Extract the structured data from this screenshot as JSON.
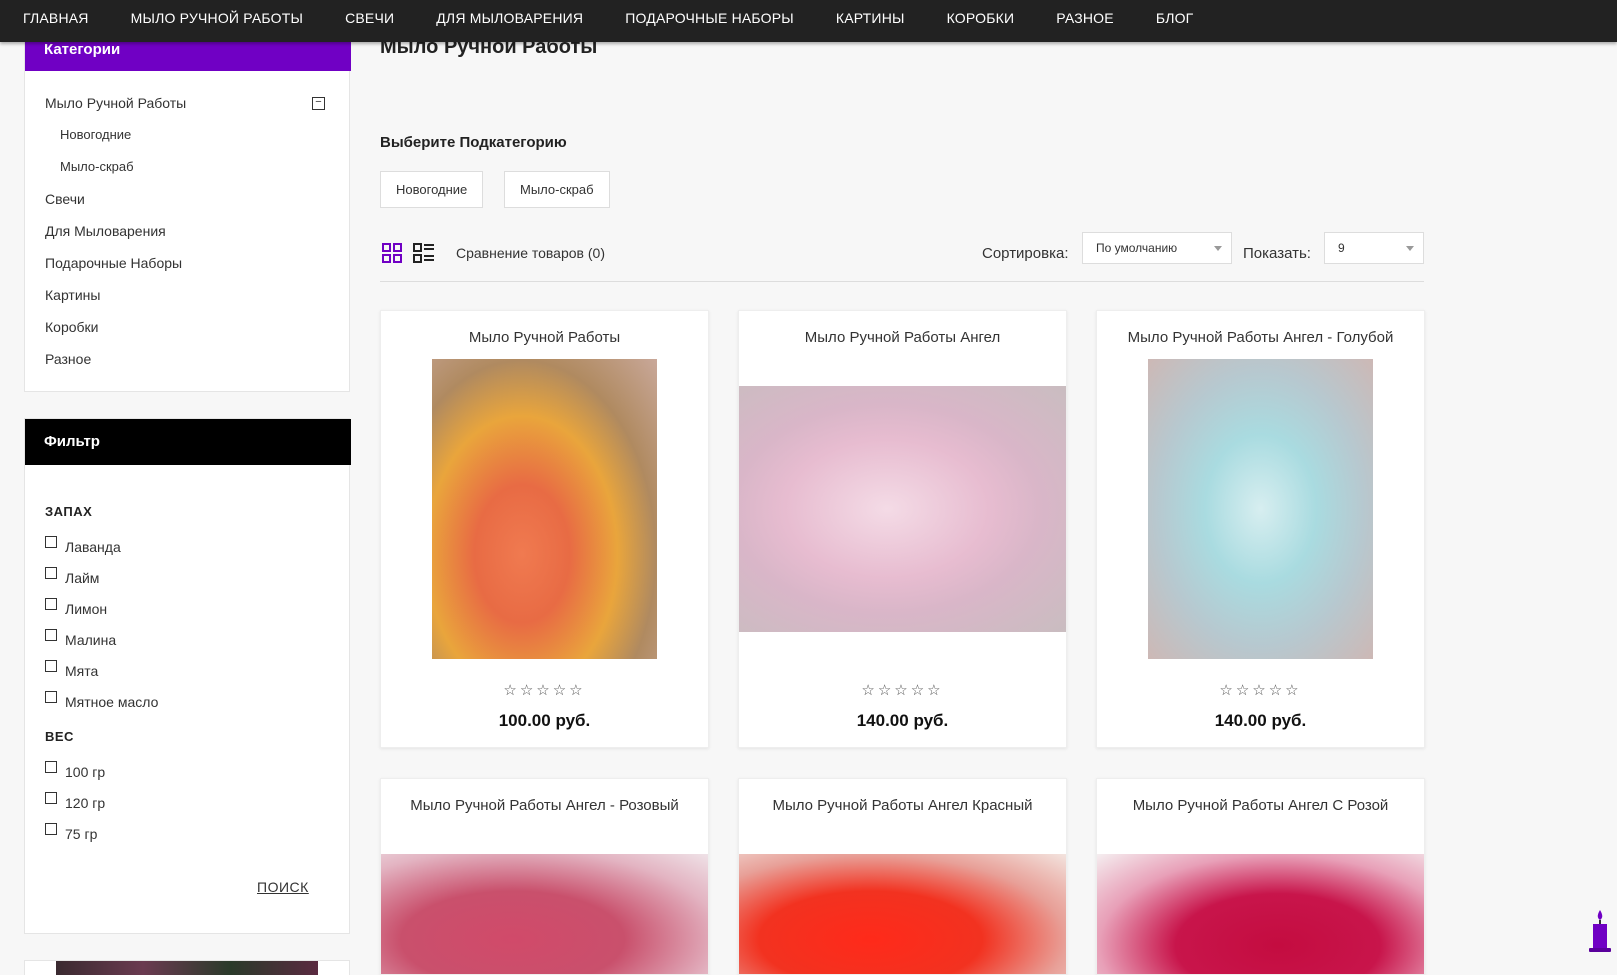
{
  "nav": {
    "items": [
      "ГЛАВНАЯ",
      "МЫЛО РУЧНОЙ РАБОТЫ",
      "СВЕЧИ",
      "ДЛЯ МЫЛОВАРЕНИЯ",
      "ПОДАРОЧНЫЕ НАБОРЫ",
      "КАРТИНЫ",
      "КОРОБКИ",
      "РАЗНОЕ",
      "БЛОГ"
    ]
  },
  "categories": {
    "title": "Категории",
    "items": [
      {
        "label": "Мыло Ручной Работы",
        "expanded": true
      },
      {
        "label": "Новогодние",
        "sub": true
      },
      {
        "label": "Мыло-скраб",
        "sub": true
      },
      {
        "label": "Свечи"
      },
      {
        "label": "Для Мыловарения"
      },
      {
        "label": "Подарочные Наборы"
      },
      {
        "label": "Картины"
      },
      {
        "label": "Коробки"
      },
      {
        "label": "Разное"
      }
    ],
    "collapse_symbol": "−"
  },
  "filter": {
    "title": "Фильтр",
    "groups": [
      {
        "title": "ЗАПАХ",
        "options": [
          "Лаванда",
          "Лайм",
          "Лимон",
          "Малина",
          "Мята",
          "Мятное масло"
        ]
      },
      {
        "title": "ВЕС",
        "options": [
          "100 гр",
          "120 гр",
          "75 гр"
        ]
      }
    ],
    "search_label": "ПОИСК"
  },
  "main": {
    "page_title": "Мыло Ручной Работы",
    "subcat_title": "Выберите Подкатегорию",
    "subcats": [
      "Новогодние",
      "Мыло-скраб"
    ],
    "compare_label": "Сравнение товаров (0)",
    "sort_label": "Сортировка:",
    "sort_value": "По умолчанию",
    "show_label": "Показать:",
    "show_value": "9"
  },
  "products": [
    {
      "name": "Мыло Ручной Работы",
      "price": "100.00 руб.",
      "stars": "☆☆☆☆☆"
    },
    {
      "name": "Мыло Ручной Работы Ангел",
      "price": "140.00 руб.",
      "stars": "☆☆☆☆☆"
    },
    {
      "name": "Мыло Ручной Работы Ангел - Голубой",
      "price": "140.00 руб.",
      "stars": "☆☆☆☆☆"
    },
    {
      "name": "Мыло Ручной Работы Ангел - Розовый"
    },
    {
      "name": "Мыло Ручной Работы Ангел Красный"
    },
    {
      "name": "Мыло Ручной Работы Ангел С Розой"
    }
  ],
  "colors": {
    "nav_bg": "#222222",
    "category_header": "#7000c4",
    "filter_header": "#000000",
    "accent_icon": "#7000c4"
  }
}
